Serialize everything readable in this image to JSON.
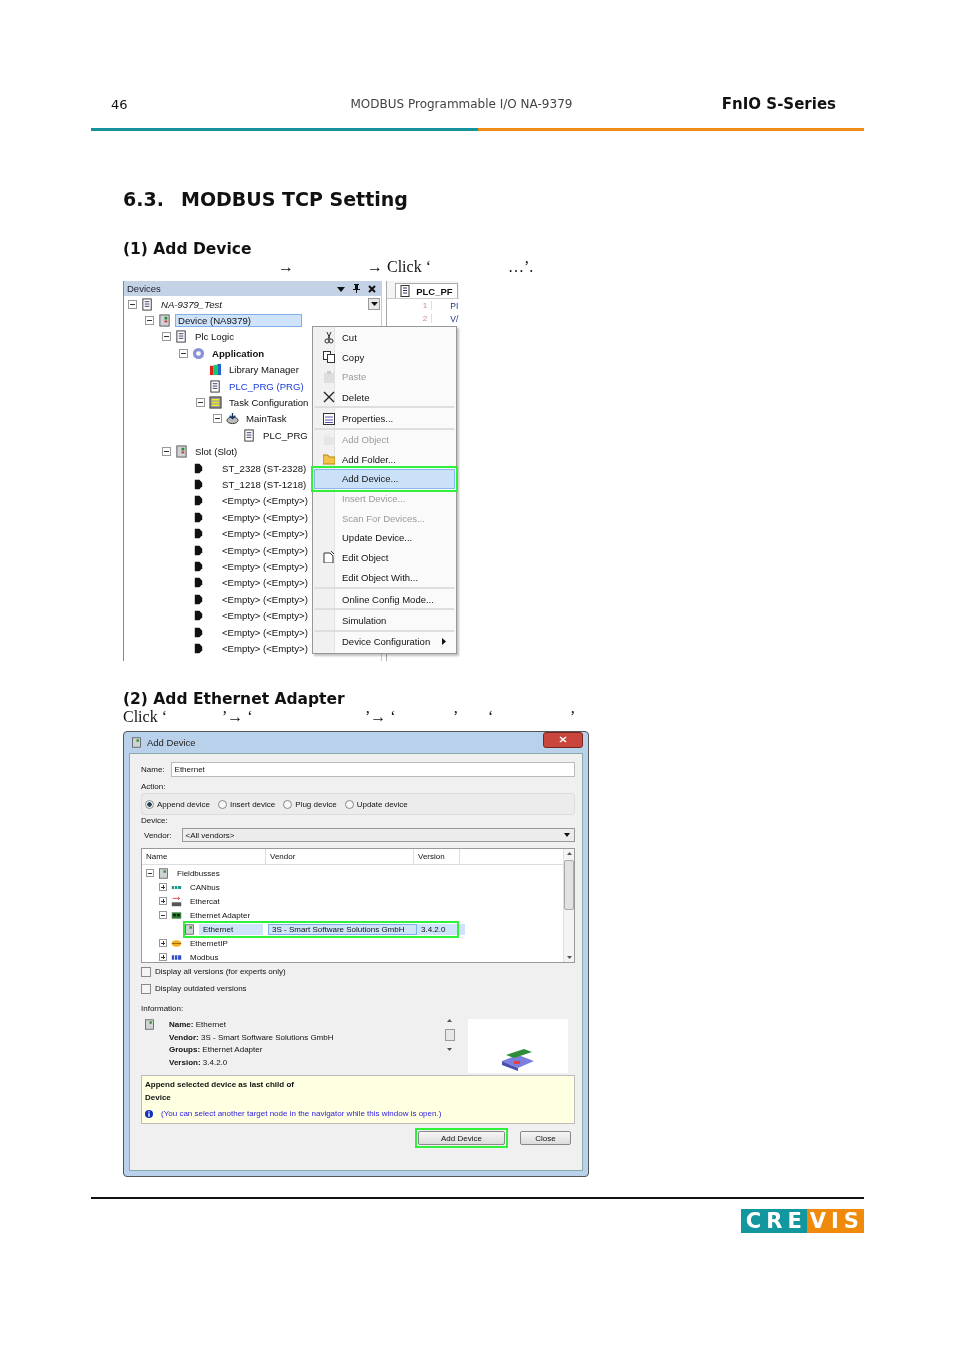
{
  "header": {
    "page_number": "46",
    "document_title": "MODBUS Programmable I/O NA-9379",
    "series": "FnIO  S-Series"
  },
  "section": {
    "number": "6.3.",
    "title": "MODBUS TCP Setting"
  },
  "step_1": {
    "heading": "(1) Add Device",
    "instruction": [
      "→",
      "→ Click ‘",
      "…’."
    ]
  },
  "devices_panel": {
    "title": "Devices",
    "tree": [
      {
        "label": "NA-9379_Test",
        "kind": "project",
        "expanded": true,
        "selected": false,
        "children": [
          {
            "label": "Device (NA9379)",
            "kind": "device",
            "expanded": true,
            "selected": true,
            "children": [
              {
                "label": "Plc Logic",
                "kind": "logic",
                "expanded": true,
                "selected": false,
                "children": [
                  {
                    "label": "Application",
                    "kind": "app",
                    "expanded": true,
                    "selected": false,
                    "children": [
                      {
                        "label": "Library Manager",
                        "kind": "library",
                        "selected": false
                      },
                      {
                        "label": "PLC_PRG (PRG)",
                        "kind": "pou",
                        "selected": false
                      },
                      {
                        "label": "Task Configuration",
                        "kind": "tasks",
                        "expanded": true,
                        "selected": false,
                        "children": [
                          {
                            "label": "MainTask",
                            "kind": "task",
                            "expanded": true,
                            "selected": false,
                            "children": [
                              {
                                "label": "PLC_PRG",
                                "kind": "call",
                                "selected": false
                              }
                            ]
                          }
                        ]
                      }
                    ]
                  }
                ]
              },
              {
                "label": "Slot (Slot)",
                "kind": "slot",
                "expanded": true,
                "selected": false,
                "children": [
                  {
                    "label": "ST_2328 (ST-2328)",
                    "kind": "module",
                    "selected": false
                  },
                  {
                    "label": "ST_1218 (ST-1218)",
                    "kind": "module",
                    "selected": false
                  },
                  {
                    "label": "<Empty> (<Empty>)",
                    "kind": "empty",
                    "selected": false
                  },
                  {
                    "label": "<Empty> (<Empty>)",
                    "kind": "empty",
                    "selected": false
                  },
                  {
                    "label": "<Empty> (<Empty>)",
                    "kind": "empty",
                    "selected": false
                  },
                  {
                    "label": "<Empty> (<Empty>)",
                    "kind": "empty",
                    "selected": false
                  },
                  {
                    "label": "<Empty> (<Empty>)",
                    "kind": "empty",
                    "selected": false
                  },
                  {
                    "label": "<Empty> (<Empty>)",
                    "kind": "empty",
                    "selected": false
                  },
                  {
                    "label": "<Empty> (<Empty>)",
                    "kind": "empty",
                    "selected": false
                  },
                  {
                    "label": "<Empty> (<Empty>)",
                    "kind": "empty",
                    "selected": false
                  },
                  {
                    "label": "<Empty> (<Empty>)",
                    "kind": "empty",
                    "selected": false
                  },
                  {
                    "label": "<Empty> (<Empty>)",
                    "kind": "empty",
                    "selected": false
                  }
                ]
              }
            ]
          }
        ]
      }
    ]
  },
  "editor": {
    "tab": "PLC_PF",
    "lines": [
      {
        "number": "1",
        "code": "PI"
      },
      {
        "number": "2",
        "code": "V/"
      }
    ]
  },
  "context_menu": [
    {
      "label": "Cut",
      "kind": "cut",
      "disabled": false,
      "selected": false,
      "highlighted": false
    },
    {
      "label": "Copy",
      "kind": "copy",
      "disabled": false,
      "selected": false,
      "highlighted": false
    },
    {
      "label": "Paste",
      "kind": "paste",
      "disabled": true,
      "selected": false,
      "highlighted": false
    },
    {
      "label": "Delete",
      "kind": "delete",
      "disabled": false,
      "selected": false,
      "highlighted": false,
      "divider_after": true
    },
    {
      "label": "Properties...",
      "kind": "properties",
      "disabled": false,
      "selected": false,
      "highlighted": false,
      "divider_after": true
    },
    {
      "label": "Add Object",
      "kind": "object",
      "disabled": true,
      "selected": false,
      "highlighted": false
    },
    {
      "label": "Add Folder...",
      "kind": "folder",
      "disabled": false,
      "selected": false,
      "highlighted": false
    },
    {
      "label": "Add Device...",
      "kind": "plain",
      "disabled": false,
      "selected": true,
      "highlighted": true
    },
    {
      "label": "Insert Device...",
      "kind": "plain",
      "disabled": true,
      "selected": false,
      "highlighted": false
    },
    {
      "label": "Scan For Devices...",
      "kind": "plain",
      "disabled": true,
      "selected": false,
      "highlighted": false
    },
    {
      "label": "Update Device...",
      "kind": "plain",
      "disabled": false,
      "selected": false,
      "highlighted": false
    },
    {
      "label": "Edit Object",
      "kind": "edit",
      "disabled": false,
      "selected": false,
      "highlighted": false
    },
    {
      "label": "Edit Object With...",
      "kind": "plain",
      "disabled": false,
      "selected": false,
      "highlighted": false,
      "divider_after": true
    },
    {
      "label": "Online Config Mode...",
      "kind": "plain",
      "disabled": false,
      "selected": false,
      "highlighted": false,
      "divider_after": true
    },
    {
      "label": "Simulation",
      "kind": "plain",
      "disabled": false,
      "selected": false,
      "highlighted": false,
      "divider_after": true
    },
    {
      "label": "Device Configuration",
      "kind": "plain",
      "disabled": false,
      "selected": false,
      "highlighted": false,
      "submenu": true
    }
  ],
  "step_2": {
    "heading": "(2) Add Ethernet Adapter",
    "instruction": [
      "Click ‘",
      "’→ ‘",
      "’→ ‘",
      "’",
      "‘",
      "’"
    ]
  },
  "dialog": {
    "title": "Add Device",
    "name_label": "Name:",
    "name_value": "Ethernet",
    "action_label": "Action:",
    "actions": [
      {
        "label": "Append device",
        "selected": true
      },
      {
        "label": "Insert device",
        "selected": false
      },
      {
        "label": "Plug device",
        "selected": false
      },
      {
        "label": "Update device",
        "selected": false
      }
    ],
    "device_label": "Device:",
    "vendor_label": "Vendor:",
    "vendor_value": "<All vendors>",
    "columns": [
      "Name",
      "Vendor",
      "Version"
    ],
    "tree": [
      {
        "label": "Fieldbusses",
        "kind": "fieldbus",
        "expanded": true,
        "selected": false,
        "children": [
          {
            "label": "CANbus",
            "kind": "can",
            "expanded": false,
            "selected": false
          },
          {
            "label": "Ethercat",
            "kind": "ethercat",
            "expanded": false,
            "selected": false
          },
          {
            "label": "Ethernet Adapter",
            "kind": "adapter",
            "expanded": true,
            "selected": false,
            "children": [
              {
                "label": "Ethernet",
                "kind": "device",
                "selected": true,
                "highlighted": true,
                "vendor": "3S - Smart Software Solutions GmbH",
                "version": "3.4.2.0"
              }
            ]
          },
          {
            "label": "EthernetIP",
            "kind": "eip",
            "expanded": false,
            "selected": false
          },
          {
            "label": "Modbus",
            "kind": "modbus",
            "expanded": false,
            "selected": false
          }
        ]
      }
    ],
    "options": [
      {
        "label": "Display all versions (for experts only)",
        "checked": false
      },
      {
        "label": "Display outdated versions",
        "checked": false
      }
    ],
    "information_label": "Information:",
    "information": [
      "**Name:** Ethernet",
      "**Vendor:** 3S - Smart Software Solutions GmbH",
      "**Groups:** Ethernet Adapter",
      "**Version:** 3.4.2.0"
    ],
    "hint_title": "Append selected device as last child of",
    "hint_target": "Device",
    "hint_note": "(You can select another target node in the navigator while this window is open.)",
    "buttons": [
      {
        "label": "Add Device",
        "highlighted": true
      },
      {
        "label": "Close",
        "highlighted": false
      }
    ]
  },
  "logo": {
    "left": "CRE",
    "right": "VIS"
  }
}
